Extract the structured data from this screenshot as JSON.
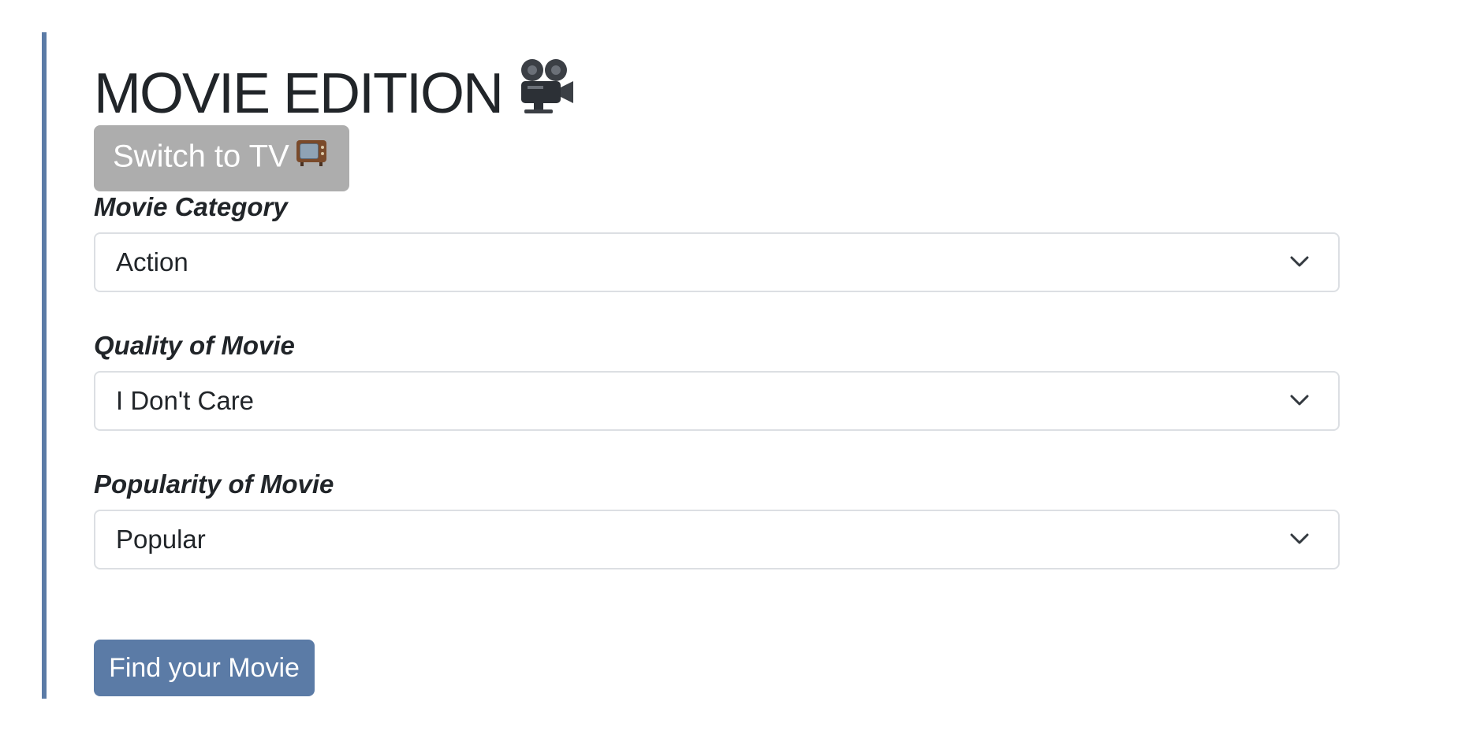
{
  "header": {
    "title": "MOVIE EDITION",
    "title_icon": "movie-camera-icon"
  },
  "switch_button": {
    "label": "Switch to TV",
    "icon": "television-icon",
    "color": "#adadad"
  },
  "form": {
    "fields": [
      {
        "label": "Movie Category",
        "selected": "Action"
      },
      {
        "label": "Quality of Movie",
        "selected": "I Don't Care"
      },
      {
        "label": "Popularity of Movie",
        "selected": "Popular"
      }
    ]
  },
  "submit_button": {
    "label": "Find your Movie",
    "color": "#5b7ba6"
  },
  "accent_color": "#5b7ba6"
}
